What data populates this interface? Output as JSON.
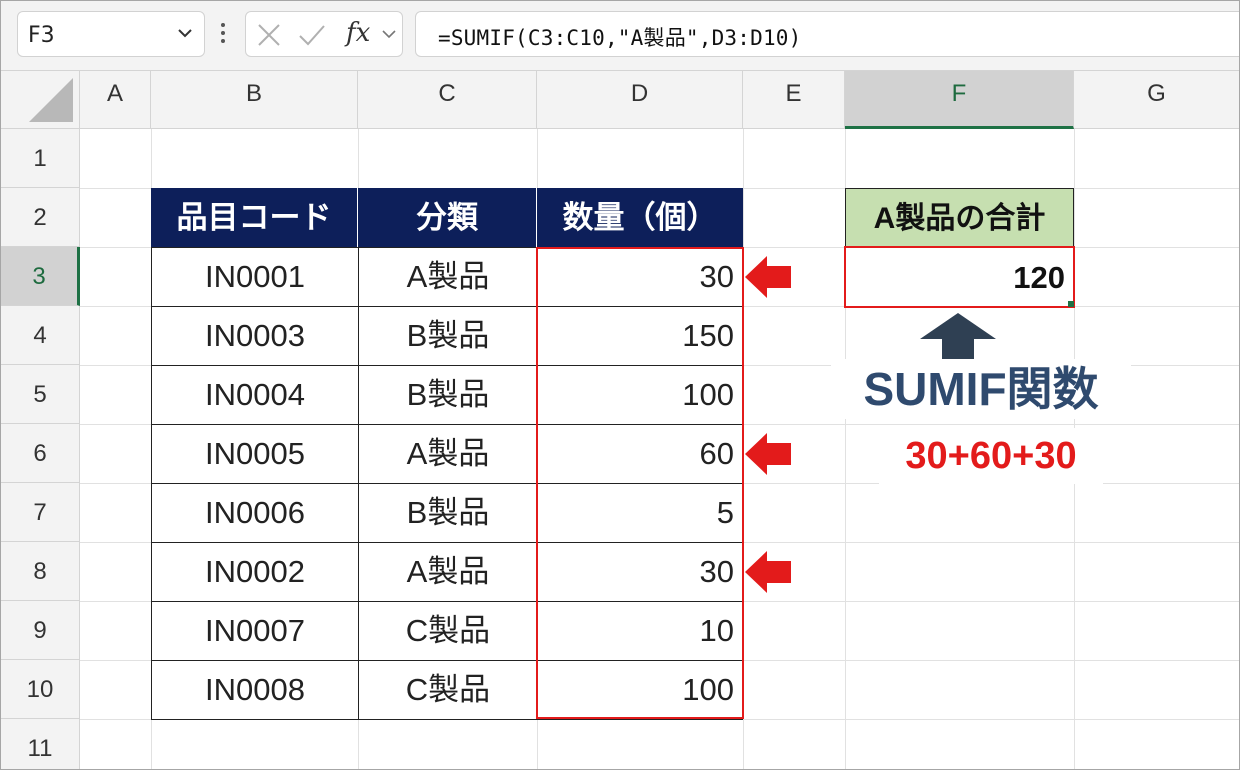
{
  "name_box": {
    "value": "F3"
  },
  "formula_bar": {
    "formula": "=SUMIF(C3:C10,\"A製品\",D3:D10)",
    "fx_label": "fx"
  },
  "columns": [
    "A",
    "B",
    "C",
    "D",
    "E",
    "F",
    "G"
  ],
  "selected_column": "F",
  "rows": [
    "1",
    "2",
    "3",
    "4",
    "5",
    "6",
    "7",
    "8",
    "9",
    "10",
    "11"
  ],
  "selected_row": "3",
  "table": {
    "headers": [
      "品目コード",
      "分類",
      "数量（個）"
    ],
    "rows": [
      {
        "code": "IN0001",
        "category": "A製品",
        "qty": "30"
      },
      {
        "code": "IN0003",
        "category": "B製品",
        "qty": "150"
      },
      {
        "code": "IN0004",
        "category": "B製品",
        "qty": "100"
      },
      {
        "code": "IN0005",
        "category": "A製品",
        "qty": "60"
      },
      {
        "code": "IN0006",
        "category": "B製品",
        "qty": "5"
      },
      {
        "code": "IN0002",
        "category": "A製品",
        "qty": "30"
      },
      {
        "code": "IN0007",
        "category": "C製品",
        "qty": "10"
      },
      {
        "code": "IN0008",
        "category": "C製品",
        "qty": "100"
      }
    ]
  },
  "summary": {
    "label": "A製品の合計",
    "value": "120"
  },
  "annotation": {
    "function_name": "SUMIF関数",
    "expression": "30+60+30"
  },
  "colors": {
    "header_bg": "#0d1f5a",
    "label_bg": "#c6dfb0",
    "highlight": "#e31b1b",
    "accent_green": "#1e7145",
    "arrow_dark": "#2f4053"
  }
}
